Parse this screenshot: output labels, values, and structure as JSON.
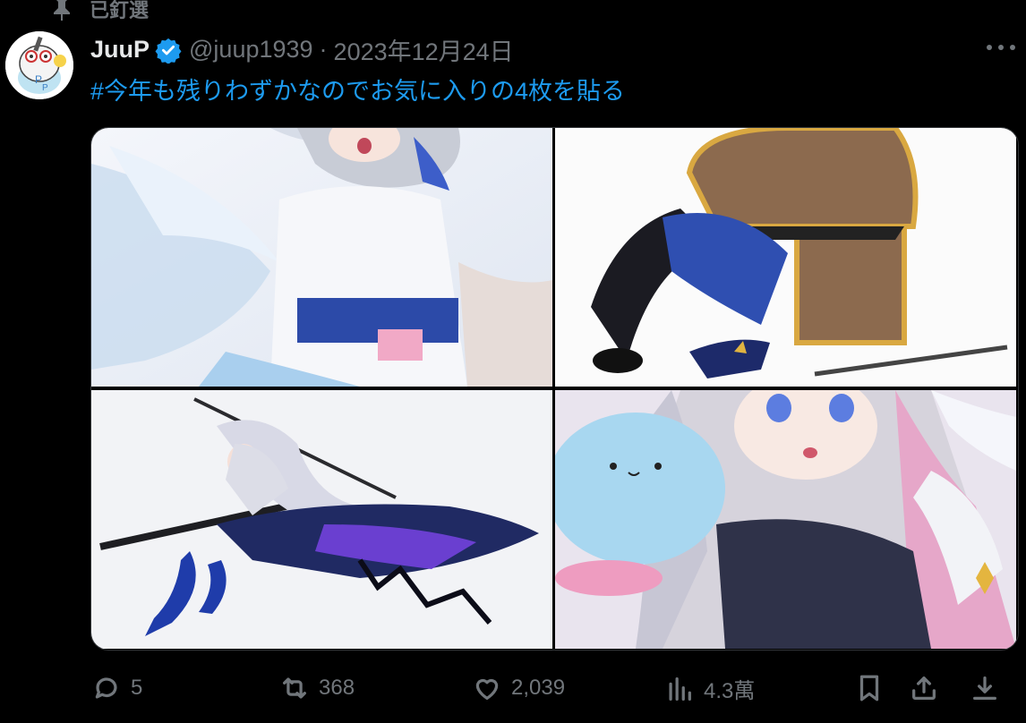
{
  "pinned": {
    "label": "已釘選"
  },
  "author": {
    "name": "JuuP",
    "handle": "@juup1939",
    "separator": "·",
    "date": "2023年12月24日"
  },
  "tweet": {
    "text": "#今年も残りわずかなのでお気に入りの4枚を貼る"
  },
  "media": [
    {
      "subject": "angel-girl-closeup"
    },
    {
      "subject": "treasure-chest-mimic"
    },
    {
      "subject": "girl-with-katana"
    },
    {
      "subject": "girl-with-plush"
    }
  ],
  "stats": {
    "replies": "5",
    "reposts": "368",
    "likes": "2,039",
    "views": "4.3萬"
  },
  "colors": {
    "background": "#000000",
    "accent": "#1d9bf0",
    "muted": "#71767b",
    "text": "#e7e9ea"
  },
  "icons": [
    "pin-icon",
    "verified-icon",
    "more-icon",
    "reply-icon",
    "repost-icon",
    "like-icon",
    "views-icon",
    "bookmark-icon",
    "share-icon",
    "download-icon"
  ]
}
